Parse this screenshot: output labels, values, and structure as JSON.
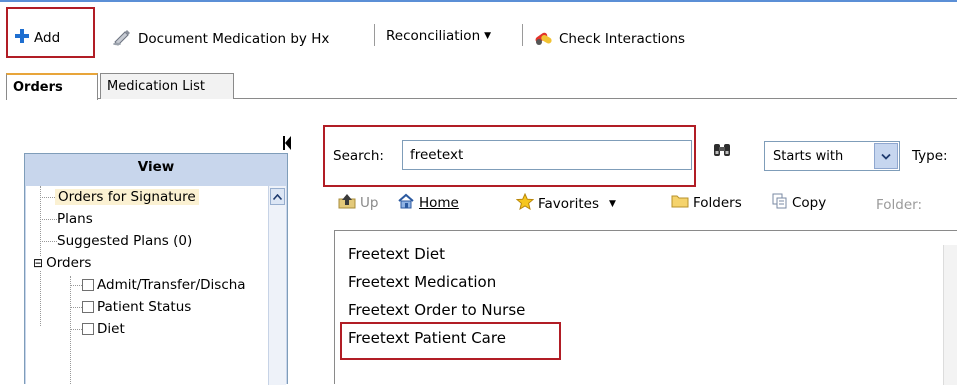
{
  "toolbar": {
    "add_label": "Add",
    "document_label": "Document Medication by Hx",
    "reconciliation_label": "Reconciliation",
    "check_label": "Check Interactions"
  },
  "tabs": [
    {
      "label": "Orders",
      "active": true
    },
    {
      "label": "Medication List",
      "active": false
    }
  ],
  "view_panel": {
    "header": "View",
    "items": [
      {
        "label": "Orders for Signature",
        "selected": true
      },
      {
        "label": "Plans"
      },
      {
        "label": "Suggested Plans (0)"
      },
      {
        "label": "Orders",
        "expander": "⊟"
      },
      {
        "label": "Admit/Transfer/Discha",
        "checkbox": true
      },
      {
        "label": "Patient Status",
        "checkbox": true
      },
      {
        "label": "Diet",
        "checkbox": true
      }
    ]
  },
  "search": {
    "label": "Search:",
    "value": "freetext",
    "match_mode": "Starts with",
    "type_label": "Type:"
  },
  "nav_toolbar": {
    "up": "Up",
    "home": "Home",
    "favorites": "Favorites",
    "folders": "Folders",
    "copy": "Copy",
    "folder_label": "Folder:"
  },
  "results": [
    {
      "label": "Freetext Diet"
    },
    {
      "label": "Freetext Medication"
    },
    {
      "label": "Freetext Order to Nurse"
    },
    {
      "label": "Freetext Patient Care",
      "highlighted": true
    }
  ],
  "colors": {
    "highlight_border": "#b11d25",
    "panel_bg": "#c8d6ec",
    "selected_bg": "#fbf1d2",
    "active_tab_accent": "#e8a53a"
  }
}
